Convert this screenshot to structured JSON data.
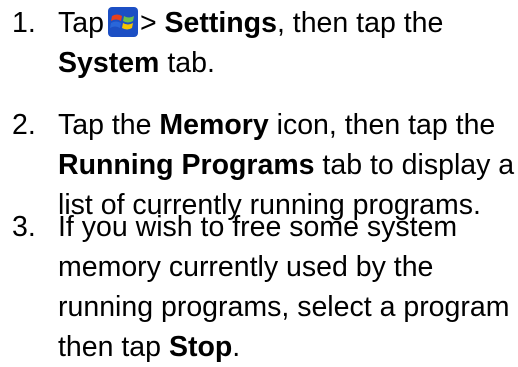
{
  "steps": [
    {
      "number": "1.",
      "line1": {
        "t1": "Tap",
        "t2": "> ",
        "b1": "Settings",
        "t3": ", then tap the"
      },
      "line2": {
        "b1": "System",
        "t1": " tab."
      },
      "icon": "windows-start-icon"
    },
    {
      "number": "2.",
      "line1": {
        "t1": "Tap the ",
        "b1": "Memory",
        "t2": " icon, then tap the"
      },
      "line2": {
        "b1": "Running Programs",
        "t1": " tab to display a"
      },
      "line3": "list of currently running programs."
    },
    {
      "number": "3.",
      "line1": "If you wish to free some system",
      "line2": "memory currently used by the",
      "line3": "running programs, select a program",
      "line4": {
        "t1": "then tap ",
        "b1": "Stop",
        "t2": "."
      }
    }
  ],
  "colors": {
    "text": "#000000",
    "icon_red": "#e8401c",
    "icon_green": "#6cc04a",
    "icon_blue": "#2a66d9",
    "icon_yellow": "#f5c400",
    "icon_bg": "#1c4fc4"
  }
}
